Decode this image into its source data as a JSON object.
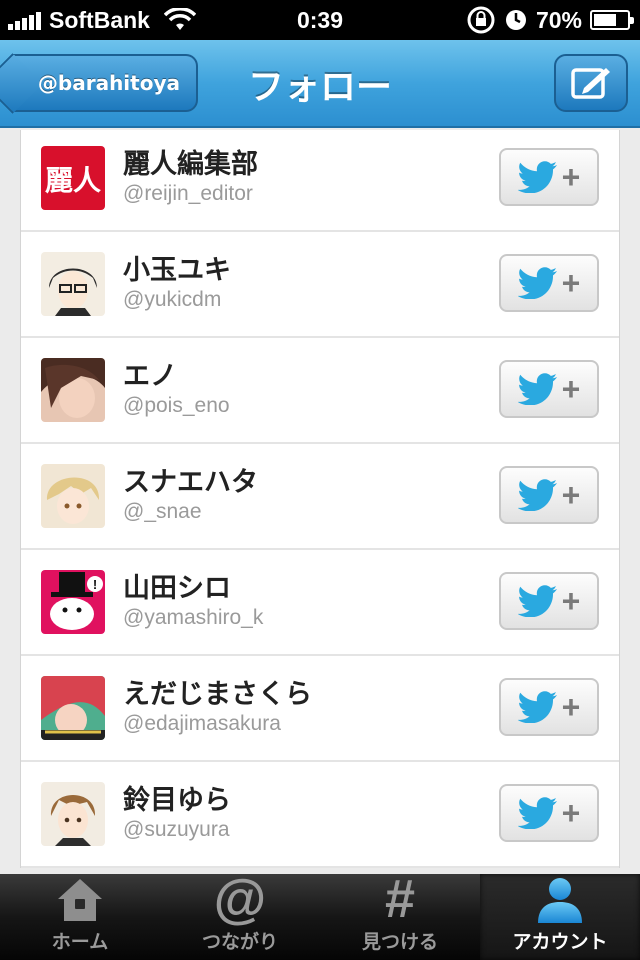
{
  "status_bar": {
    "carrier": "SoftBank",
    "time": "0:39",
    "battery": "70%",
    "battery_level": 0.7,
    "icons": [
      "signal-icon",
      "wifi-icon",
      "rotation-lock-icon",
      "alarm-icon",
      "battery-icon"
    ]
  },
  "nav": {
    "back_label": "@barahitoya",
    "title": "フォロー",
    "compose_icon": "compose-icon"
  },
  "accent_color": "#3fa3dd",
  "users": [
    {
      "name": "麗人編集部",
      "handle": "@reijin_editor",
      "avatar": "reijin-logo"
    },
    {
      "name": "小玉ユキ",
      "handle": "@yukicdm",
      "avatar": "illustration-glasses-man"
    },
    {
      "name": "エノ",
      "handle": "@pois_eno",
      "avatar": "illustration-dark-hair"
    },
    {
      "name": "スナエハタ",
      "handle": "@_snae",
      "avatar": "illustration-blond-boy"
    },
    {
      "name": "山田シロ",
      "handle": "@yamashiro_k",
      "avatar": "illustration-top-hat"
    },
    {
      "name": "えだじまさくら",
      "handle": "@edajimasakura",
      "avatar": "illustration-red-hair"
    },
    {
      "name": "鈴目ゆら",
      "handle": "@suzuyura",
      "avatar": "illustration-brown-hair"
    }
  ],
  "follow_button_icon": "twitter-bird-plus-icon",
  "tabs": [
    {
      "label": "ホーム",
      "icon": "home-icon",
      "active": false
    },
    {
      "label": "つながり",
      "icon": "at-icon",
      "active": false
    },
    {
      "label": "見つける",
      "icon": "hash-icon",
      "active": false
    },
    {
      "label": "アカウント",
      "icon": "person-icon",
      "active": true
    }
  ]
}
